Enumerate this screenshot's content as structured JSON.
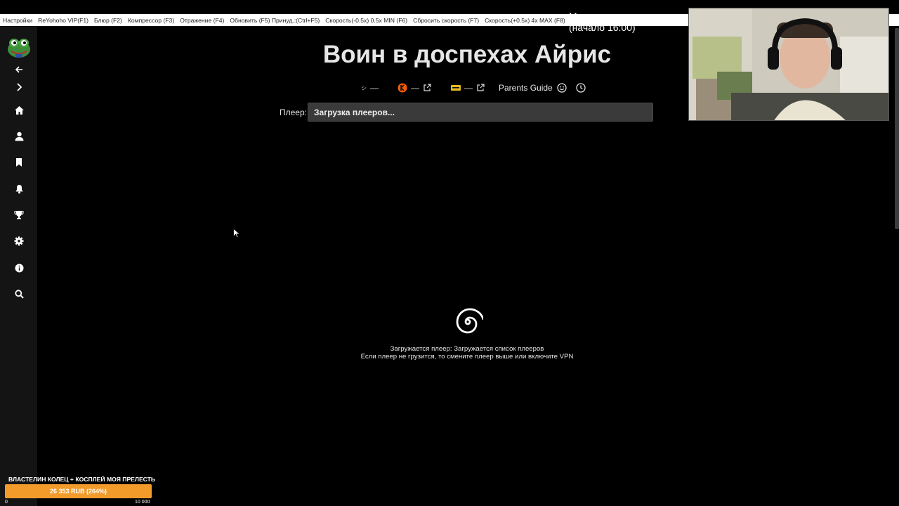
{
  "menu": [
    "Настройки",
    "ReYohoho VIP(F1)",
    "Блюр (F2)",
    "Компрессор (F3)",
    "Отражение (F4)",
    "Обновить (F5) Принуд.:(Ctrl+F5)",
    "Скорость(-0.5x) 0.5x MIN (F6)",
    "Сбросить скорость (F7)",
    "Скорость(+0.5x) 4x MAX (F8)"
  ],
  "page": {
    "title": "Воин в доспехах Айрис",
    "rating1_value": "—",
    "rating2_value": "—",
    "rating3_value": "—",
    "parents_guide": "Parents Guide"
  },
  "player": {
    "label": "Плеер:",
    "selected": "Загрузка плееров..."
  },
  "loading": {
    "line1": "Загружается плеер: Загружается список плееров",
    "line2": "Если плеер не грузится, то смените плеер выше или включите VPN"
  },
  "overlay": {
    "partial_text": "М... ...",
    "start_time": "(начало 16:00)"
  },
  "donation": {
    "title": "ВЛАСТЕЛИН КОЛЕЦ + КОСПЛЕЙ МОЯ ПРЕЛЕСТЬ",
    "amount": "26 353 RUB (264%)",
    "min": "0",
    "max": "10 000",
    "progress_percent": 264
  },
  "colors": {
    "background": "#000000",
    "sidebar": "#141414",
    "accent": "#f29b2a",
    "select_bg": "#3a3a3a"
  },
  "icons": [
    "arrow-left-icon",
    "chevron-right-icon",
    "home-icon",
    "user-icon",
    "bookmark-icon",
    "bell-icon",
    "trophy-icon",
    "gear-icon",
    "info-icon",
    "search-icon"
  ]
}
